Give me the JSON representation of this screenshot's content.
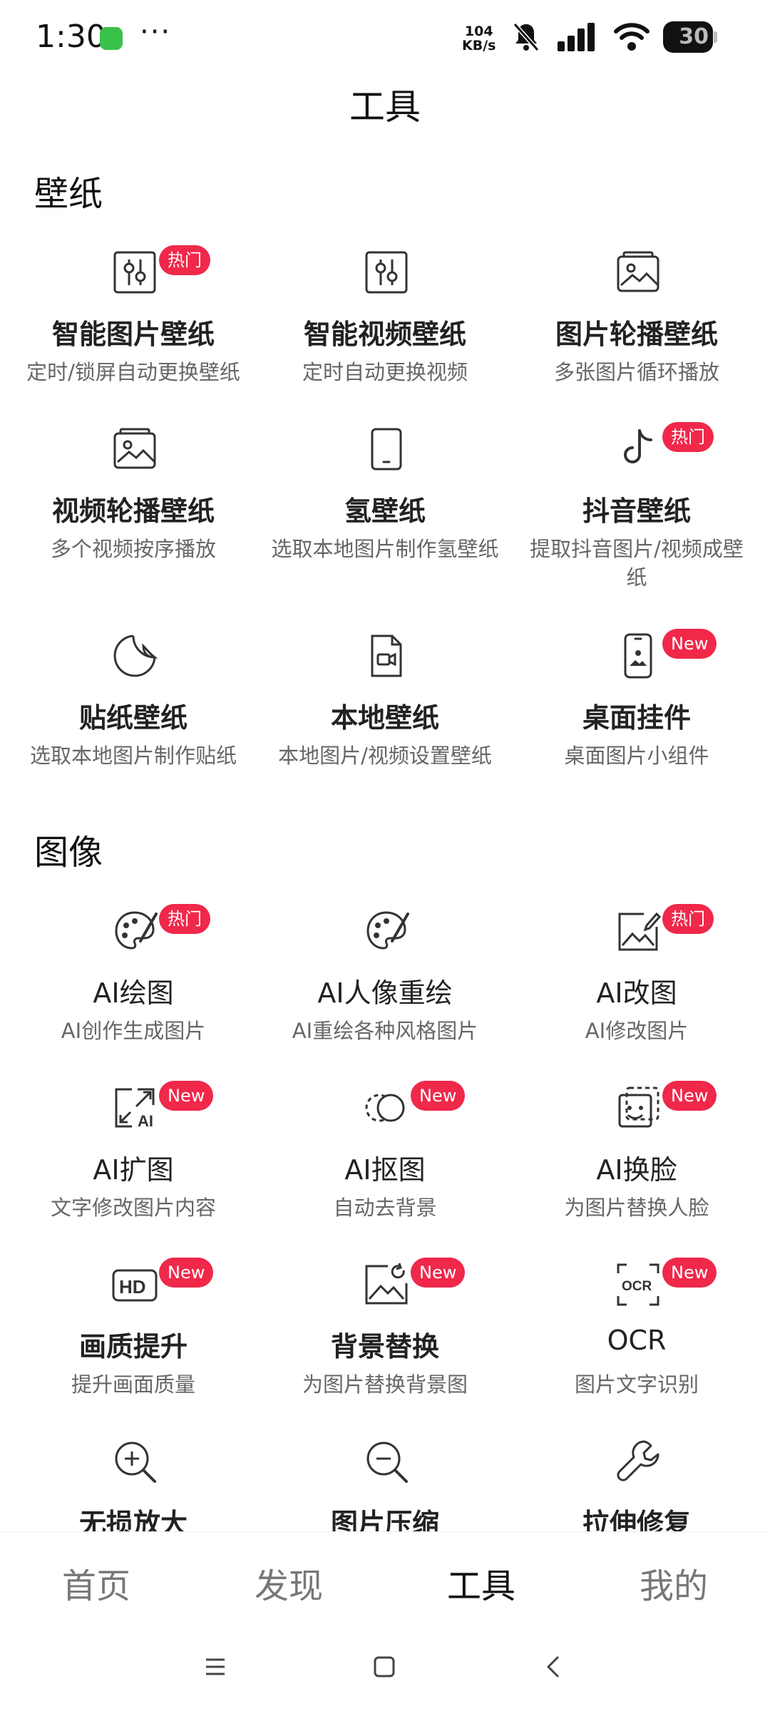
{
  "status": {
    "time": "1:30",
    "speed_top": "104",
    "speed_bottom": "KB/s",
    "battery": "30"
  },
  "page_title": "工具",
  "sections": [
    {
      "title": "壁纸",
      "tiles": [
        {
          "icon": "sliders-icon",
          "name": "智能图片壁纸",
          "desc": "定时/锁屏自动更换壁纸",
          "badge": "热门"
        },
        {
          "icon": "sliders-icon",
          "name": "智能视频壁纸",
          "desc": "定时自动更换视频",
          "badge": ""
        },
        {
          "icon": "image-stack-icon",
          "name": "图片轮播壁纸",
          "desc": "多张图片循环播放",
          "badge": ""
        },
        {
          "icon": "image-stack-icon",
          "name": "视频轮播壁纸",
          "desc": "多个视频按序播放",
          "badge": ""
        },
        {
          "icon": "tablet-icon",
          "name": "氢壁纸",
          "desc": "选取本地图片制作氢壁纸",
          "badge": ""
        },
        {
          "icon": "tiktok-icon",
          "name": "抖音壁纸",
          "desc": "提取抖音图片/视频成壁纸",
          "badge": "热门"
        },
        {
          "icon": "sticker-icon",
          "name": "贴纸壁纸",
          "desc": "选取本地图片制作贴纸",
          "badge": ""
        },
        {
          "icon": "video-file-icon",
          "name": "本地壁纸",
          "desc": "本地图片/视频设置壁纸",
          "badge": ""
        },
        {
          "icon": "phone-widget-icon",
          "name": "桌面挂件",
          "desc": "桌面图片小组件",
          "badge": "New"
        }
      ]
    },
    {
      "title": "图像",
      "tiles": [
        {
          "icon": "palette-icon",
          "name": "AI绘图",
          "desc": "AI创作生成图片",
          "badge": "热门"
        },
        {
          "icon": "palette-icon",
          "name": "AI人像重绘",
          "desc": "AI重绘各种风格图片",
          "badge": ""
        },
        {
          "icon": "image-edit-icon",
          "name": "AI改图",
          "desc": "AI修改图片",
          "badge": "热门"
        },
        {
          "icon": "expand-ai-icon",
          "name": "AI扩图",
          "desc": "文字修改图片内容",
          "badge": "New"
        },
        {
          "icon": "cutout-icon",
          "name": "AI抠图",
          "desc": "自动去背景",
          "badge": "New"
        },
        {
          "icon": "face-swap-icon",
          "name": "AI换脸",
          "desc": "为图片替换人脸",
          "badge": "New"
        },
        {
          "icon": "hd-icon",
          "name": "画质提升",
          "desc": "提升画面质量",
          "badge": "New"
        },
        {
          "icon": "background-replace-icon",
          "name": "背景替换",
          "desc": "为图片替换背景图",
          "badge": "New"
        },
        {
          "icon": "ocr-icon",
          "name": "OCR",
          "desc": "图片文字识别",
          "badge": "New"
        },
        {
          "icon": "zoom-in-icon",
          "name": "无损放大",
          "desc": "",
          "badge": ""
        },
        {
          "icon": "zoom-out-icon",
          "name": "图片压缩",
          "desc": "",
          "badge": ""
        },
        {
          "icon": "wrench-icon",
          "name": "拉伸修复",
          "desc": "",
          "badge": ""
        }
      ]
    }
  ],
  "tabs": [
    "首页",
    "发现",
    "工具",
    "我的"
  ],
  "active_tab": "工具",
  "colors": {
    "badge": "#f0284a",
    "text": "#222222",
    "subtext": "#666666"
  }
}
